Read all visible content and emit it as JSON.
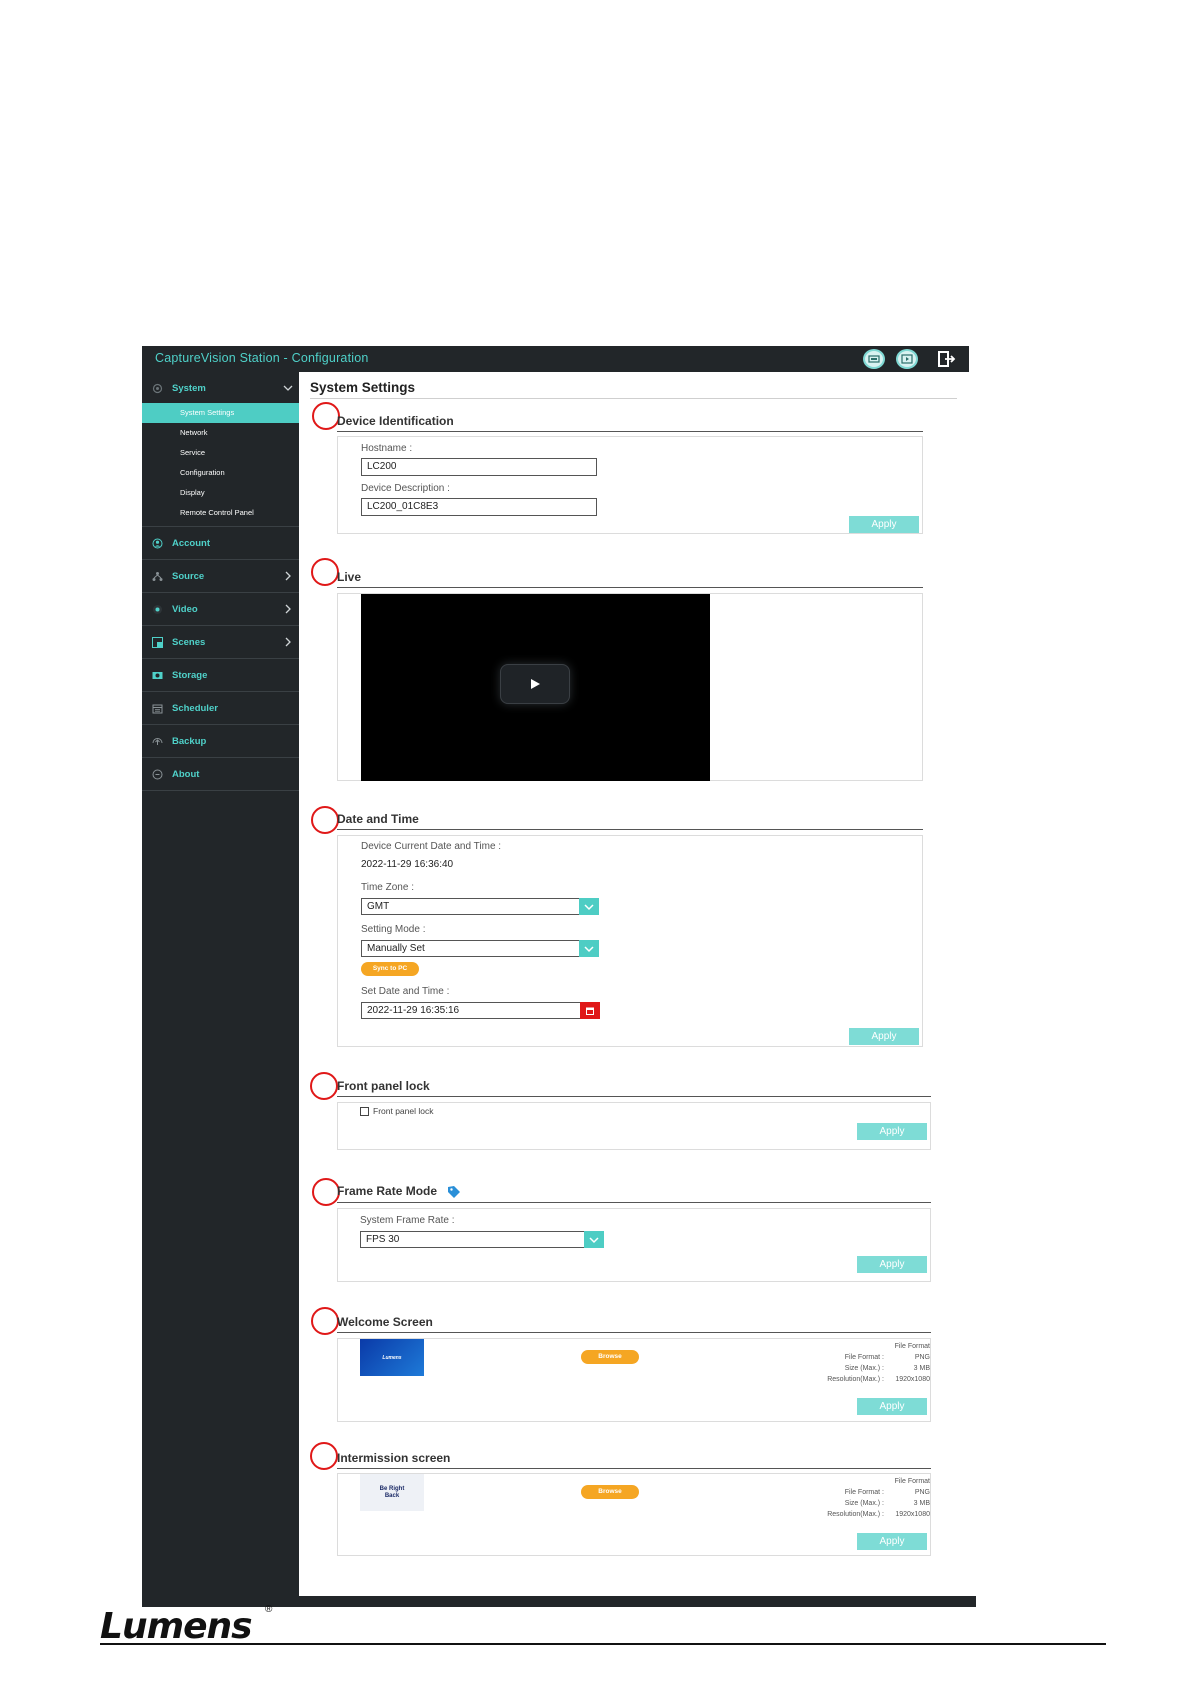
{
  "window": {
    "title": "CaptureVision Station - Configuration",
    "toolbar_icons": [
      "device-icon",
      "playback-icon",
      "logout-icon"
    ]
  },
  "colors": {
    "accent": "#4ECDC4",
    "sidebar_bg": "#222629",
    "marker": "#E01818",
    "orange": "#F5A623",
    "calendar_red": "#E01818"
  },
  "sidebar": {
    "system": {
      "label": "System",
      "icon": "system-icon"
    },
    "sub_items": [
      {
        "label": "System Settings",
        "active": true
      },
      {
        "label": "Network"
      },
      {
        "label": "Service"
      },
      {
        "label": "Configuration"
      },
      {
        "label": "Display"
      },
      {
        "label": "Remote Control Panel"
      }
    ],
    "items": [
      {
        "label": "Account",
        "icon": "account-icon"
      },
      {
        "label": "Source",
        "icon": "source-icon",
        "expandable": true
      },
      {
        "label": "Video",
        "icon": "video-icon",
        "expandable": true
      },
      {
        "label": "Scenes",
        "icon": "scenes-icon",
        "expandable": true
      },
      {
        "label": "Storage",
        "icon": "storage-icon"
      },
      {
        "label": "Scheduler",
        "icon": "scheduler-icon"
      },
      {
        "label": "Backup",
        "icon": "backup-icon"
      },
      {
        "label": "About",
        "icon": "about-icon"
      }
    ]
  },
  "main": {
    "page_title": "System Settings",
    "device_identification": {
      "heading": "Device Identification",
      "hostname_label": "Hostname :",
      "hostname_value": "LC200",
      "description_label": "Device Description :",
      "description_value": "LC200_01C8E3",
      "apply": "Apply"
    },
    "live": {
      "heading": "Live"
    },
    "date_time": {
      "heading": "Date and Time",
      "current_label": "Device Current Date and Time :",
      "current_value": "2022-11-29 16:36:40",
      "timezone_label": "Time Zone :",
      "timezone_value": "GMT",
      "mode_label": "Setting Mode :",
      "mode_value": "Manually Set",
      "sync_button": "Sync to PC",
      "set_label": "Set Date and Time :",
      "set_value": "2022-11-29 16:35:16",
      "apply": "Apply"
    },
    "front_panel_lock": {
      "heading": "Front panel lock",
      "checkbox_label": "Front panel lock",
      "checked": false,
      "apply": "Apply"
    },
    "frame_rate": {
      "heading": "Frame Rate Mode",
      "rate_label": "System Frame Rate :",
      "rate_value": "FPS 30",
      "apply": "Apply"
    },
    "welcome_screen": {
      "heading": "Welcome Screen",
      "thumb_text": "Lumens",
      "browse": "Browse",
      "file_format_title": "File Format",
      "file_format_label": "File Format :",
      "file_format_value": "PNG",
      "size_label": "Size (Max.) :",
      "size_value": "3 MB",
      "resolution_label": "Resolution(Max.) :",
      "resolution_value": "1920x1080",
      "apply": "Apply"
    },
    "intermission_screen": {
      "heading": "Intermission screen",
      "thumb_text": "Be Right Back",
      "browse": "Browse",
      "file_format_title": "File Format",
      "file_format_label": "File Format :",
      "file_format_value": "PNG",
      "size_label": "Size (Max.) :",
      "size_value": "3 MB",
      "resolution_label": "Resolution(Max.) :",
      "resolution_value": "1920x1080",
      "apply": "Apply"
    }
  },
  "footer": {
    "logo_text": "Lumens",
    "registered": "®"
  }
}
